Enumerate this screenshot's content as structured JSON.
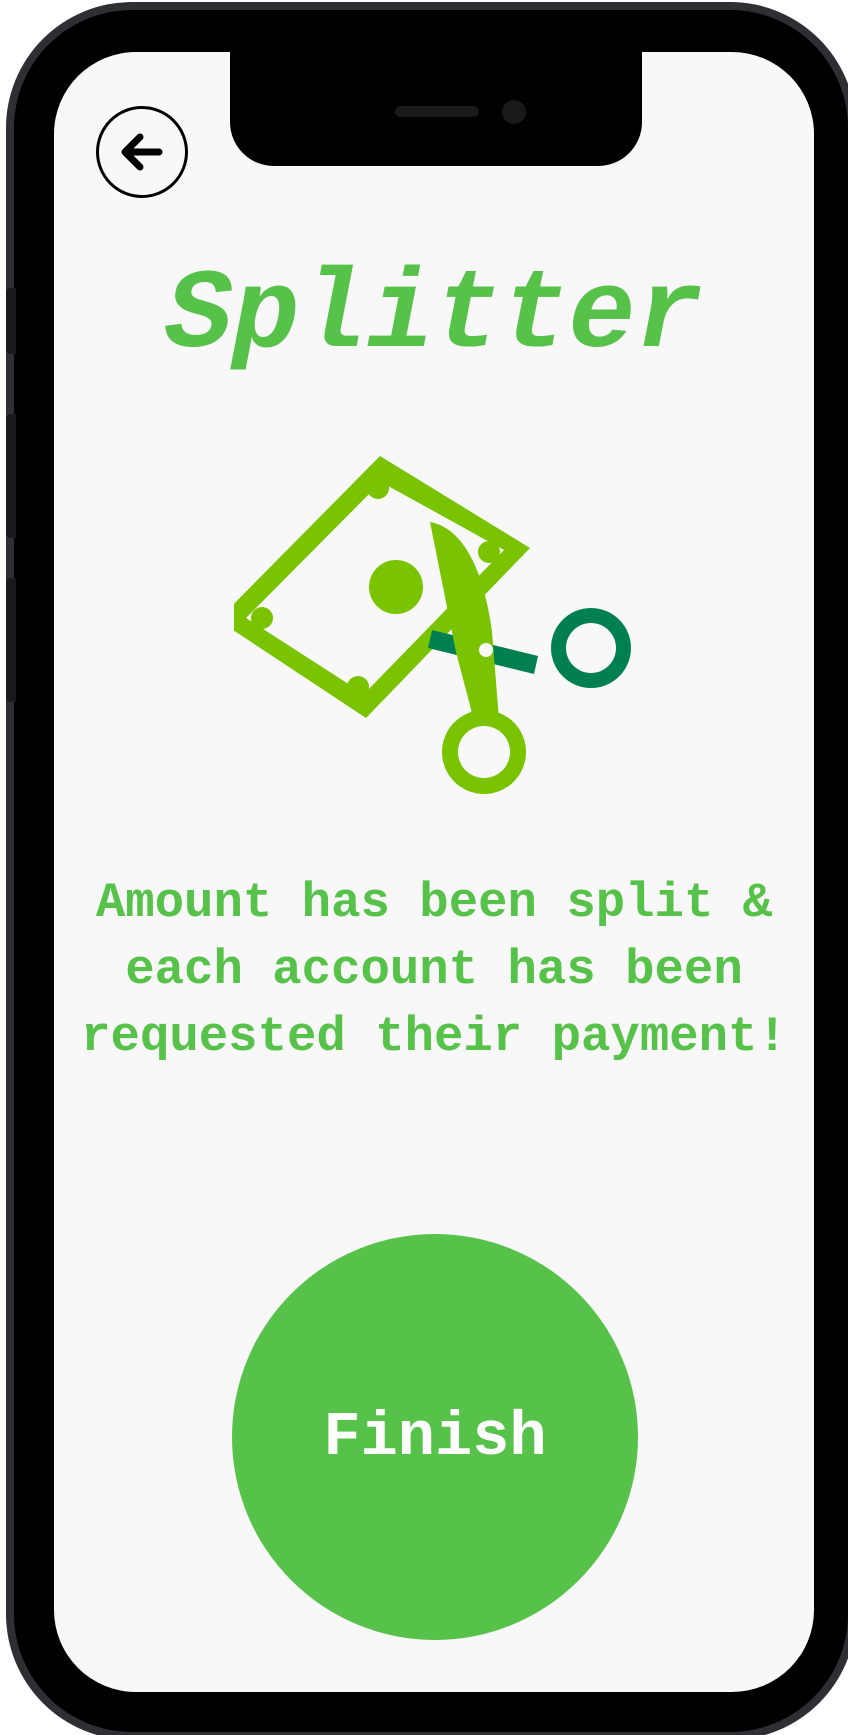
{
  "app": {
    "title": "Splitter"
  },
  "header": {
    "back_icon": "arrow-left-icon"
  },
  "illustration": {
    "icon": "money-scissors-icon"
  },
  "message": {
    "text": "Amount has been split & each account has been requested their payment!"
  },
  "actions": {
    "finish_label": "Finish"
  },
  "colors": {
    "brand_green": "#57c249",
    "illustration_green": "#79c300",
    "scissors_dark_green": "#008050",
    "screen_background": "#f8f8f8"
  }
}
